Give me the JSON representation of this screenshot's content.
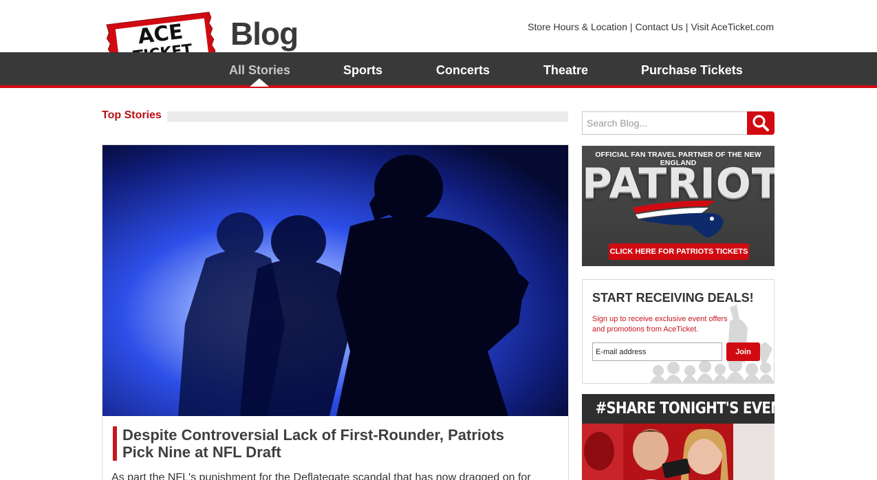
{
  "header": {
    "logo": {
      "line1": "ACE",
      "line2": "TICKET"
    },
    "blog_label": "Blog",
    "util_links": [
      "Store Hours & Location",
      "Contact Us",
      "Visit AceTicket.com"
    ],
    "util_separator": "|"
  },
  "nav": {
    "items": [
      {
        "label": "All Stories",
        "active": true
      },
      {
        "label": "Sports",
        "active": false
      },
      {
        "label": "Concerts",
        "active": false
      },
      {
        "label": "Theatre",
        "active": false
      },
      {
        "label": "Purchase Tickets",
        "active": false
      }
    ]
  },
  "main": {
    "section_title": "Top Stories",
    "story": {
      "headline": "Despite Controversial Lack of First-Rounder, Patriots Pick Nine at NFL Draft",
      "excerpt": "As part the NFL's punishment for the Deflategate scandal that has now dragged on for"
    }
  },
  "sidebar": {
    "search": {
      "placeholder": "Search Blog...",
      "icon": "search-icon"
    },
    "ad_patriots": {
      "tagline": "OFFICIAL FAN TRAVEL PARTNER OF THE NEW ENGLAND",
      "team": "PATRIOTS",
      "cta": "CLICK HERE FOR PATRIOTS TICKETS"
    },
    "deals": {
      "title": "START RECEIVING DEALS!",
      "text": "Sign up to receive exclusive event offers and promotions from AceTicket.",
      "email_placeholder": "E-mail address",
      "join_label": "Join"
    },
    "share": {
      "title": "#SHARE TONIGHT'S EVENT AND WIN!"
    }
  },
  "colors": {
    "brand_red": "#d10a11",
    "nav_bg": "#393939",
    "headline_accent": "#c8161d",
    "section_title": "#b90e13"
  }
}
